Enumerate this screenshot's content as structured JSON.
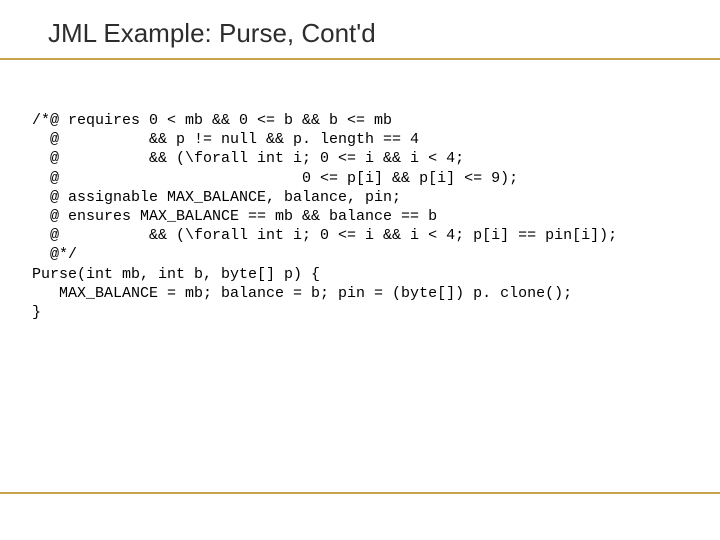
{
  "title": "JML Example: Purse, Cont'd",
  "code_lines": [
    "/*@ requires 0 < mb && 0 <= b && b <= mb",
    "  @          && p != null && p. length == 4",
    "  @          && (\\forall int i; 0 <= i && i < 4;",
    "  @                           0 <= p[i] && p[i] <= 9);",
    "  @ assignable MAX_BALANCE, balance, pin;",
    "  @ ensures MAX_BALANCE == mb && balance == b",
    "  @          && (\\forall int i; 0 <= i && i < 4; p[i] == pin[i]);",
    "  @*/",
    "Purse(int mb, int b, byte[] p) {",
    "   MAX_BALANCE = mb; balance = b; pin = (byte[]) p. clone();",
    "}"
  ]
}
